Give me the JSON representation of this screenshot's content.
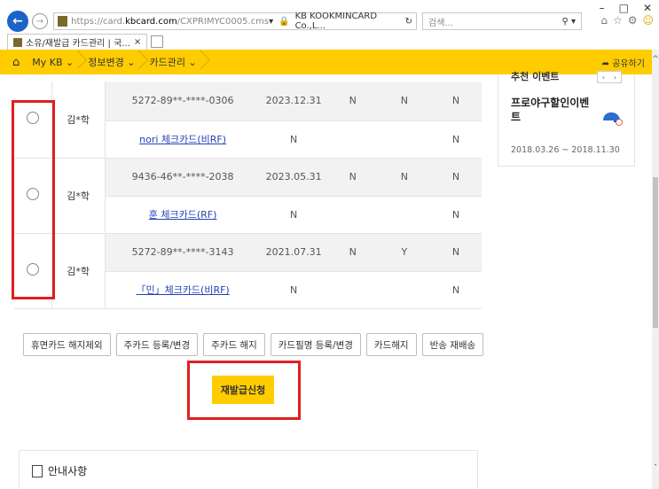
{
  "browser": {
    "url_prefix": "https://card.",
    "url_host": "kbcard.com",
    "url_rest": "/CXPRIMYC0005.cms",
    "cert": "KB KOOKMINCARD Co.,L...",
    "search_placeholder": "검색...",
    "tab_title": "소유/재발급 카드관리 | 국..."
  },
  "nav": {
    "home_icon": "home-icon",
    "crumbs": [
      "My KB",
      "정보변경",
      "카드관리"
    ],
    "share_label": "공유하기"
  },
  "rows": [
    {
      "name": "김*학",
      "main_card": "5272-89**-****-0306",
      "main_expiry": "2023.12.31",
      "main_flags": [
        "N",
        "N",
        "N"
      ],
      "sub_card": "nori 체크카드(비RF)",
      "sub_expiry": "N",
      "sub_flags": [
        "",
        "",
        "N"
      ]
    },
    {
      "name": "김*학",
      "main_card": "9436-46**-****-2038",
      "main_expiry": "2023.05.31",
      "main_flags": [
        "N",
        "N",
        "N"
      ],
      "sub_card": "훈 체크카드(RF)",
      "sub_expiry": "N",
      "sub_flags": [
        "",
        "",
        "N"
      ]
    },
    {
      "name": "김*학",
      "main_card": "5272-89**-****-3143",
      "main_expiry": "2021.07.31",
      "main_flags": [
        "N",
        "Y",
        "N"
      ],
      "sub_card": "「민」체크카드(비RF)",
      "sub_expiry": "N",
      "sub_flags": [
        "",
        "",
        "N"
      ]
    }
  ],
  "actions": [
    "휴면카드 해지제외",
    "주카드 등록/변경",
    "주카드 해지",
    "카드필명 등록/변경",
    "카드해지",
    "반송 재배송"
  ],
  "reissue_label": "재발급신청",
  "notice_label": "안내사항",
  "promo": {
    "header": "추천 이벤트",
    "name": "프로야구할인이벤트",
    "date": "2018.03.26 ~ 2018.11.30"
  },
  "colors": {
    "brand": "#ffcc00",
    "highlight": "#e02020",
    "link": "#2442b6"
  }
}
